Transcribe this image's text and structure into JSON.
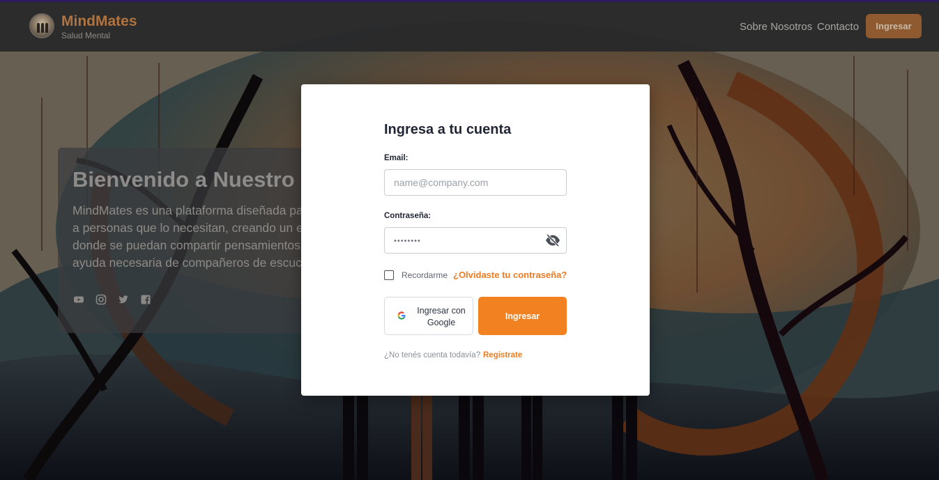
{
  "navbar": {
    "brand_name": "MindMates",
    "brand_subtitle": "Salud Mental",
    "links": [
      "Sobre Nosotros",
      "Contacto"
    ],
    "login_button": "Ingresar"
  },
  "hero": {
    "title": "Bienvenido a Nuestro",
    "lines": [
      "MindMates es una plataforma diseñada pa",
      "a personas que lo necesitan, creando un er",
      "donde se puedan compartir pensamientos,",
      "ayuda necesaria de compañeros de escuch"
    ],
    "social_icons": [
      "youtube-icon",
      "instagram-icon",
      "twitter-icon",
      "facebook-icon"
    ]
  },
  "login_modal": {
    "title": "Ingresa a tu cuenta",
    "email_label": "Email:",
    "email_placeholder": "name@company.com",
    "password_label": "Contraseña:",
    "password_masked": "••••••••",
    "remember_label": "Recordarme",
    "forgot_link": "¿Olvidaste tu contraseña?",
    "google_button": "Ingresar con Google",
    "submit_button": "Ingresar",
    "no_account_text": "¿No tenés cuenta todavía?",
    "register_link": "Registrate"
  },
  "colors": {
    "accent": "#f28122",
    "brand": "#b1733f",
    "modal_bg": "#ffffff",
    "title_text": "#1f2533"
  }
}
